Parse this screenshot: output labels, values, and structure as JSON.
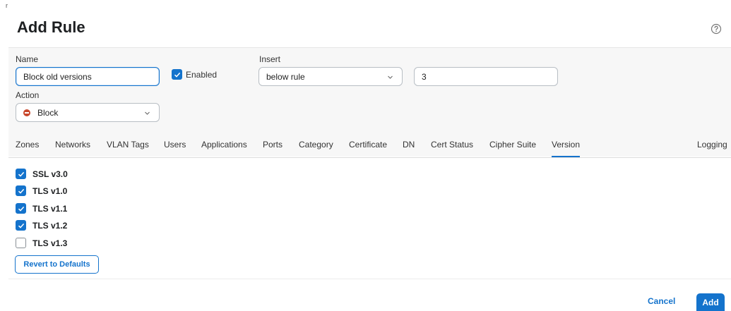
{
  "header": {
    "title": "Add Rule",
    "corner_mark": "r"
  },
  "form": {
    "name_label": "Name",
    "name_value": "Block old versions",
    "enabled_label": "Enabled",
    "enabled_checked": true,
    "insert_label": "Insert",
    "insert_value": "below rule",
    "insert_rule_number": "3",
    "action_label": "Action",
    "action_value": "Block"
  },
  "tabs": [
    {
      "label": "Zones"
    },
    {
      "label": "Networks"
    },
    {
      "label": "VLAN Tags"
    },
    {
      "label": "Users"
    },
    {
      "label": "Applications"
    },
    {
      "label": "Ports"
    },
    {
      "label": "Category"
    },
    {
      "label": "Certificate"
    },
    {
      "label": "DN"
    },
    {
      "label": "Cert Status"
    },
    {
      "label": "Cipher Suite"
    },
    {
      "label": "Version",
      "active": true
    },
    {
      "label": "Logging"
    }
  ],
  "versions": [
    {
      "label": "SSL v3.0",
      "checked": true
    },
    {
      "label": "TLS v1.0",
      "checked": true
    },
    {
      "label": "TLS v1.1",
      "checked": true
    },
    {
      "label": "TLS v1.2",
      "checked": true
    },
    {
      "label": "TLS v1.3",
      "checked": false
    }
  ],
  "buttons": {
    "revert": "Revert to Defaults",
    "cancel": "Cancel",
    "add": "Add"
  },
  "colors": {
    "accent": "#1473cc",
    "block": "#c8472c"
  },
  "icons": {
    "help": "help-circle-icon",
    "dropdown": "chevron-down-icon",
    "check": "checkmark-icon",
    "block": "block-icon"
  }
}
